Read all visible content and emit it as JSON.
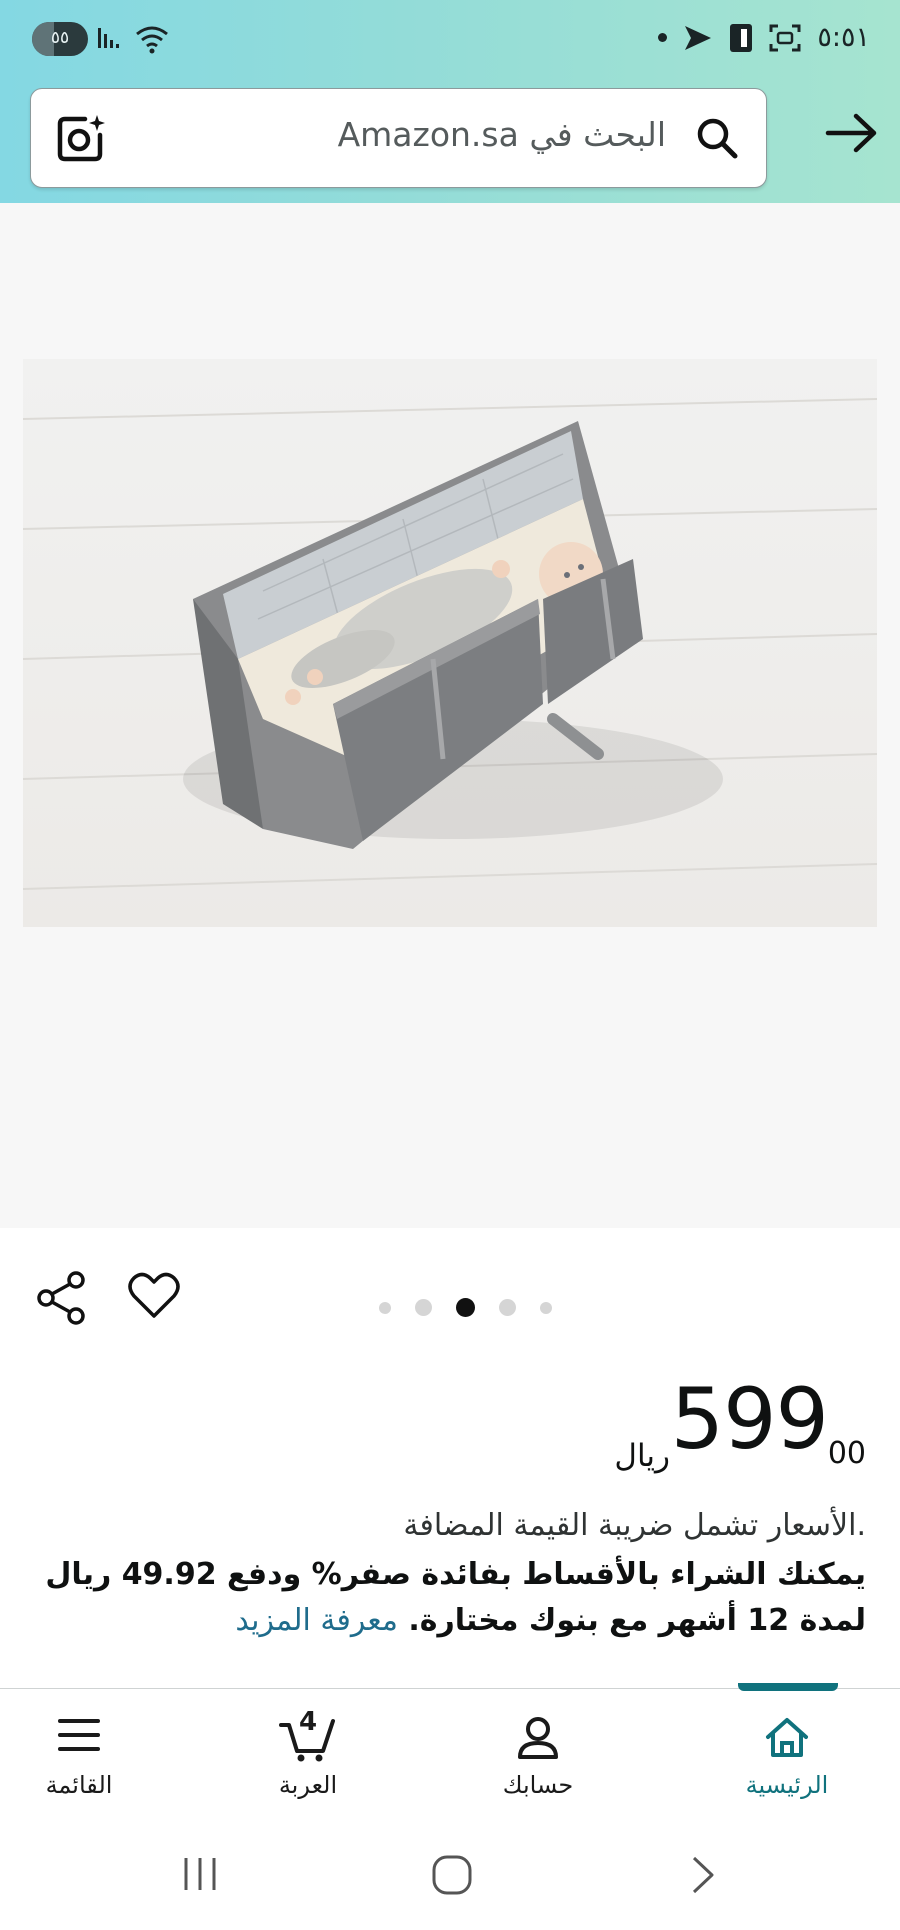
{
  "status_bar": {
    "time": "٥:٥١",
    "battery": "٥٥",
    "icons": [
      "signal-icon",
      "wifi-icon",
      "notification-dot-icon",
      "send-icon",
      "sim-icon",
      "screenshot-icon"
    ]
  },
  "search": {
    "placeholder": "البحث في Amazon.sa",
    "icons": [
      "camera-scan-icon",
      "search-icon",
      "back-arrow-icon"
    ]
  },
  "gallery": {
    "image_count": 5,
    "active_index": 2,
    "image_alt": "baby travel bed bag"
  },
  "actions": {
    "icons": [
      "share-icon",
      "heart-icon"
    ]
  },
  "price": {
    "whole": "599",
    "fraction": "00",
    "currency": "ريال"
  },
  "vat_note": ".الأسعار تشمل ضريبة القيمة المضافة",
  "installment": {
    "text": "يمكنك الشراء بالأقساط بفائدة صفر% ودفع 49.92 ريال لمدة 12 أشهر مع بنوك مختارة.",
    "link": "معرفة المزيد"
  },
  "bottom_nav": {
    "items": [
      {
        "label": "الرئيسية",
        "icon": "home-icon",
        "active": true
      },
      {
        "label": "حسابك",
        "icon": "account-icon",
        "active": false
      },
      {
        "label": "العربة",
        "icon": "cart-icon",
        "active": false,
        "count": "4"
      },
      {
        "label": "القائمة",
        "icon": "menu-icon",
        "active": false
      }
    ]
  },
  "colors": {
    "header_gradient_start": "#84d8e3",
    "header_gradient_end": "#a6e4d0",
    "accent": "#10727d",
    "link": "#1f6c8c"
  }
}
